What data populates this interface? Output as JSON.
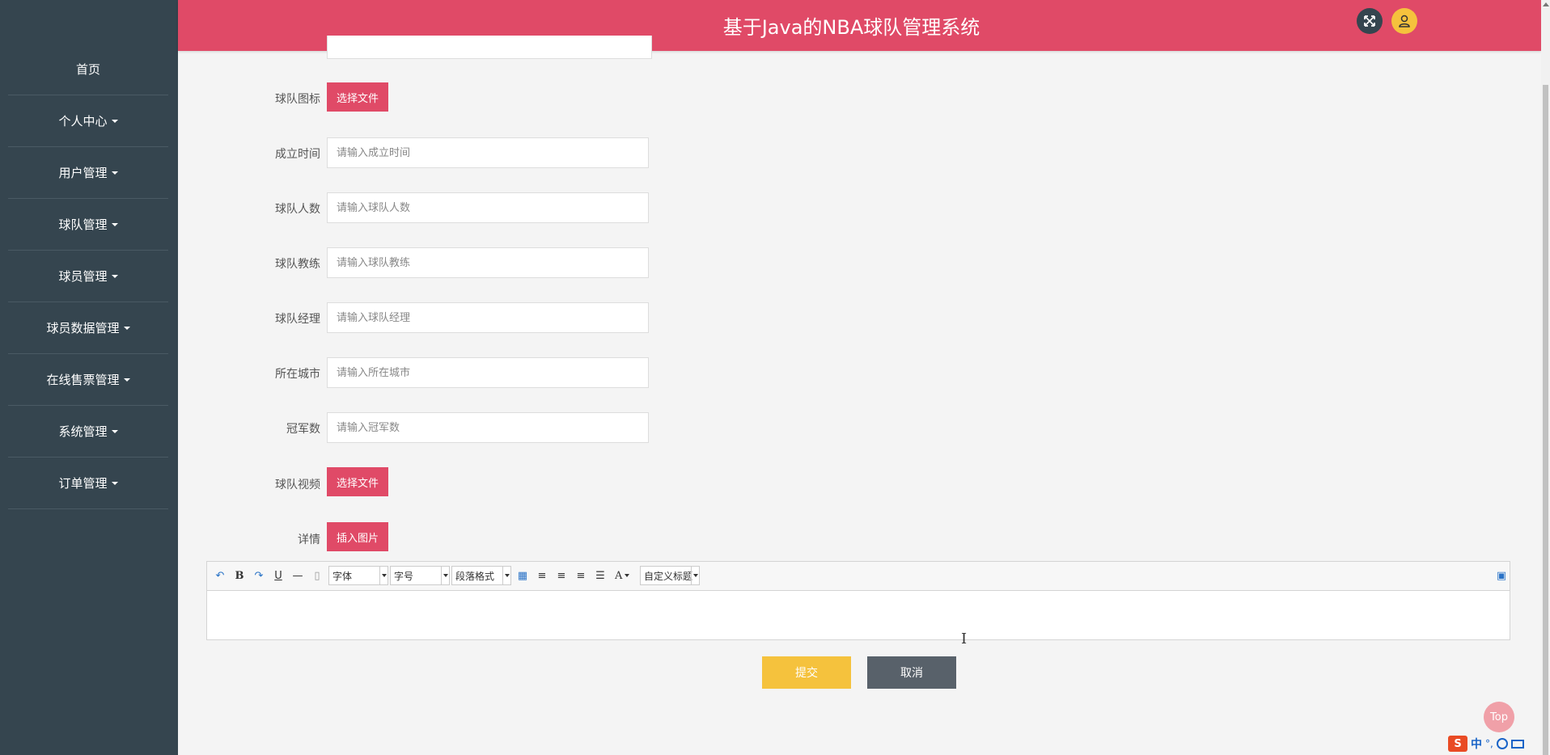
{
  "app": {
    "title": "基于Java的NBA球队管理系统"
  },
  "sidebar": {
    "items": [
      {
        "label": "首页",
        "has_caret": false
      },
      {
        "label": "个人中心",
        "has_caret": true
      },
      {
        "label": "用户管理",
        "has_caret": true
      },
      {
        "label": "球队管理",
        "has_caret": true
      },
      {
        "label": "球员管理",
        "has_caret": true
      },
      {
        "label": "球员数据管理",
        "has_caret": true
      },
      {
        "label": "在线售票管理",
        "has_caret": true
      },
      {
        "label": "系统管理",
        "has_caret": true
      },
      {
        "label": "订单管理",
        "has_caret": true
      }
    ]
  },
  "header": {
    "fullscreen_icon": "expand-icon",
    "user_icon": "user-icon"
  },
  "form": {
    "team_icon": {
      "label": "球队图标",
      "button": "选择文件"
    },
    "founded": {
      "label": "成立时间",
      "placeholder": "请输入成立时间",
      "value": ""
    },
    "team_size": {
      "label": "球队人数",
      "placeholder": "请输入球队人数",
      "value": ""
    },
    "coach": {
      "label": "球队教练",
      "placeholder": "请输入球队教练",
      "value": ""
    },
    "manager": {
      "label": "球队经理",
      "placeholder": "请输入球队经理",
      "value": ""
    },
    "city": {
      "label": "所在城市",
      "placeholder": "请输入所在城市",
      "value": ""
    },
    "championships": {
      "label": "冠军数",
      "placeholder": "请输入冠军数",
      "value": ""
    },
    "team_video": {
      "label": "球队视频",
      "button": "选择文件"
    },
    "details": {
      "label": "详情",
      "button": "插入图片"
    }
  },
  "editor": {
    "toolbar": {
      "font_family": "字体",
      "font_size": "字号",
      "paragraph": "段落格式",
      "custom_title": "自定义标题",
      "bold": "B",
      "underline": "U",
      "font_color": "A"
    }
  },
  "actions": {
    "submit": "提交",
    "cancel": "取消"
  },
  "back_to_top": "Top",
  "ime": {
    "logo": "S",
    "mode": "中",
    "punct": "°,"
  }
}
